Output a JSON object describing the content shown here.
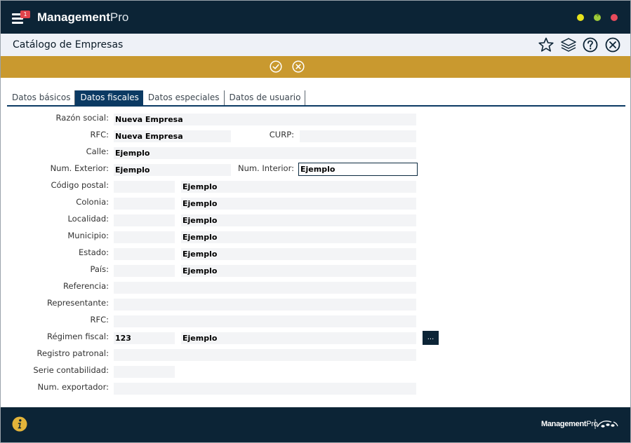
{
  "app": {
    "brand_bold": "Management",
    "brand_light": "Pro",
    "notification_count": "1"
  },
  "header": {
    "title": "Catálogo de Empresas"
  },
  "tabs": [
    {
      "label": "Datos básicos",
      "active": false
    },
    {
      "label": "Datos fiscales",
      "active": true
    },
    {
      "label": "Datos especiales",
      "active": false
    },
    {
      "label": "Datos de usuario",
      "active": false
    }
  ],
  "form": {
    "razon_social": {
      "label": "Razón social:",
      "value": "Nueva Empresa"
    },
    "rfc": {
      "label": "RFC:",
      "value": "Nueva Empresa"
    },
    "curp": {
      "label": "CURP:",
      "value": ""
    },
    "calle": {
      "label": "Calle:",
      "value": "Ejemplo"
    },
    "num_exterior": {
      "label": "Num. Exterior:",
      "value": "Ejemplo"
    },
    "num_interior": {
      "label": "Num. Interior:",
      "value": "Ejemplo"
    },
    "codigo_postal": {
      "label": "Código postal:",
      "code": "",
      "value": "Ejemplo"
    },
    "colonia": {
      "label": "Colonia:",
      "code": "",
      "value": "Ejemplo"
    },
    "localidad": {
      "label": "Localidad:",
      "code": "",
      "value": "Ejemplo"
    },
    "municipio": {
      "label": "Municipio:",
      "code": "",
      "value": "Ejemplo"
    },
    "estado": {
      "label": "Estado:",
      "code": "",
      "value": "Ejemplo"
    },
    "pais": {
      "label": "País:",
      "code": "",
      "value": "Ejemplo"
    },
    "referencia": {
      "label": "Referencia:",
      "value": ""
    },
    "representante": {
      "label": "Representante:",
      "value": ""
    },
    "rfc_representante": {
      "label": "RFC:",
      "value": ""
    },
    "regimen_fiscal": {
      "label": "Régimen fiscal:",
      "code": "123",
      "value": "Ejemplo",
      "button_label": "..."
    },
    "registro_patronal": {
      "label": "Registro patronal:",
      "value": ""
    },
    "serie_contabilidad": {
      "label": "Serie contabilidad:",
      "value": ""
    },
    "num_exportador": {
      "label": "Num. exportador:",
      "value": ""
    }
  },
  "footer": {
    "brand_bold": "Management",
    "brand_light": "Pro"
  },
  "icons": {
    "menu": "hamburger-icon",
    "star": "star-icon",
    "layers": "layers-icon",
    "help": "help-icon",
    "close": "close-icon",
    "confirm": "check-circle-icon",
    "cancel": "x-circle-icon",
    "info": "info-icon"
  },
  "colors": {
    "navy": "#0c2436",
    "gold": "#c9992f",
    "tab_active": "#0b3a63",
    "title_bg": "#eef1f7",
    "field_bg": "#f3f4f6"
  }
}
